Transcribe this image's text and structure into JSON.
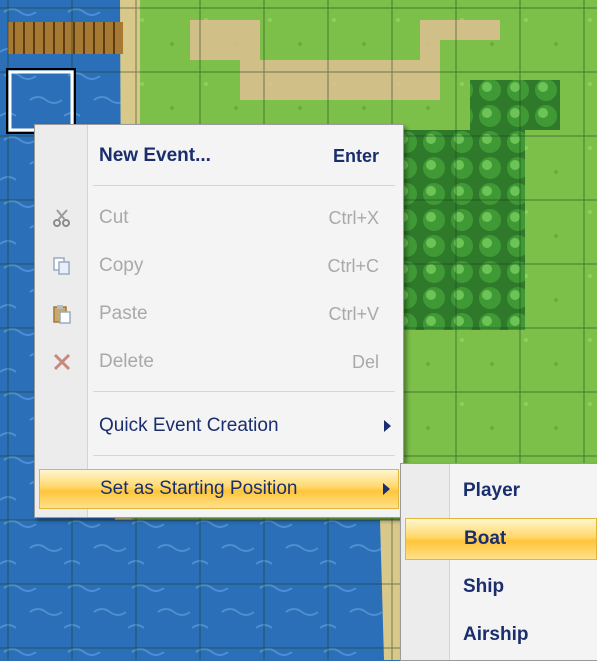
{
  "context_menu": {
    "items": [
      {
        "label": "New Event...",
        "shortcut": "Enter",
        "icon": "none"
      },
      {
        "label": "Cut",
        "shortcut": "Ctrl+X",
        "icon": "scissors-icon",
        "disabled": true
      },
      {
        "label": "Copy",
        "shortcut": "Ctrl+C",
        "icon": "copy-icon",
        "disabled": true
      },
      {
        "label": "Paste",
        "shortcut": "Ctrl+V",
        "icon": "paste-icon",
        "disabled": true
      },
      {
        "label": "Delete",
        "shortcut": "Del",
        "icon": "delete-x-icon",
        "disabled": true
      },
      {
        "label": "Quick Event Creation",
        "submenu": true
      },
      {
        "label": "Set as Starting Position",
        "submenu": true,
        "highlighted": true
      }
    ]
  },
  "submenu": {
    "items": [
      {
        "label": "Player"
      },
      {
        "label": "Boat",
        "highlighted": true
      },
      {
        "label": "Ship"
      },
      {
        "label": "Airship"
      }
    ]
  },
  "colors": {
    "water": "#2a6fb8",
    "grass": "#7cc04a",
    "grid": "#3a5a2a",
    "menu_bg": "#f4f4f4",
    "menu_text": "#1a2e6e",
    "disabled_text": "#a9a9a9",
    "highlight": "#ffd86b"
  }
}
